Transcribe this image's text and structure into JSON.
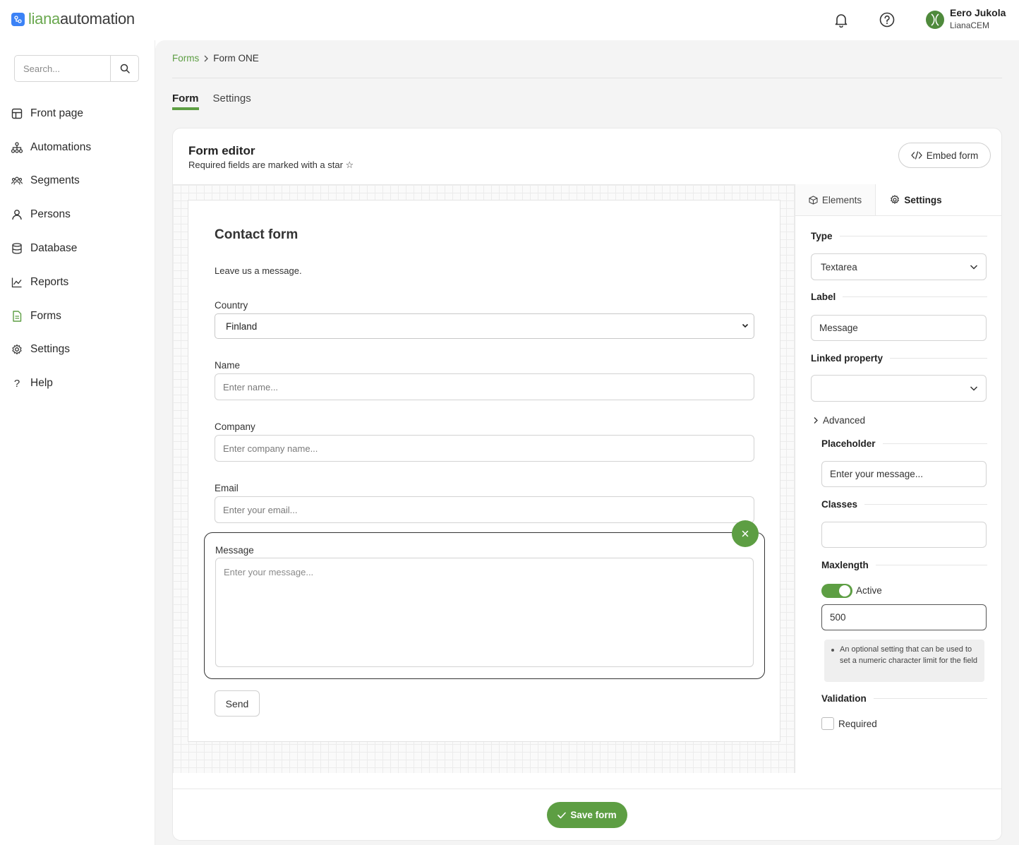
{
  "app": {
    "logo_part1": "liana",
    "logo_part2": "automation",
    "brand_color": "#5d9e43"
  },
  "topbar": {
    "icons": [
      "bell-icon",
      "help-circle-icon"
    ],
    "user_name": "Eero Jukola",
    "user_org": "LianaCEM"
  },
  "sidebar": {
    "search_placeholder": "Search...",
    "items": [
      {
        "label": "Front page",
        "icon": "grid-icon"
      },
      {
        "label": "Automations",
        "icon": "sitemap-icon"
      },
      {
        "label": "Segments",
        "icon": "users-group-icon"
      },
      {
        "label": "Persons",
        "icon": "person-icon"
      },
      {
        "label": "Database",
        "icon": "database-icon"
      },
      {
        "label": "Reports",
        "icon": "chart-line-icon"
      },
      {
        "label": "Forms",
        "icon": "document-icon",
        "active": true
      },
      {
        "label": "Settings",
        "icon": "gear-icon"
      },
      {
        "label": "Help",
        "icon": "question-icon"
      }
    ]
  },
  "breadcrumb": {
    "parent": "Forms",
    "current": "Form ONE"
  },
  "tabs": [
    {
      "label": "Form",
      "active": true
    },
    {
      "label": "Settings",
      "active": false
    }
  ],
  "editor": {
    "title": "Form editor",
    "subtitle": "Required fields are marked with a star ☆",
    "embed_label": "Embed form"
  },
  "form": {
    "heading": "Contact form",
    "description": "Leave us a message.",
    "country_label": "Country",
    "country_value": "Finland",
    "name_label": "Name",
    "name_placeholder": "Enter name...",
    "company_label": "Company",
    "company_placeholder": "Enter company name...",
    "email_label": "Email",
    "email_placeholder": "Enter your email...",
    "message_label": "Message",
    "message_placeholder": "Enter your message...",
    "send_label": "Send"
  },
  "panel": {
    "tab_elements": "Elements",
    "tab_settings": "Settings",
    "type_label": "Type",
    "type_value": "Textarea",
    "label_label": "Label",
    "label_value": "Message",
    "linked_label": "Linked property",
    "linked_value": "",
    "advanced_label": "Advanced",
    "placeholder_label": "Placeholder",
    "placeholder_value": "Enter your message...",
    "classes_label": "Classes",
    "classes_value": "",
    "maxlength_label": "Maxlength",
    "maxlength_toggle_label": "Active",
    "maxlength_toggle_on": true,
    "maxlength_value": "500",
    "maxlength_hint": "An optional setting that can be used to set a numeric character limit for the field",
    "validation_label": "Validation",
    "required_label": "Required",
    "required_checked": false
  },
  "footer": {
    "save_label": "Save form"
  }
}
